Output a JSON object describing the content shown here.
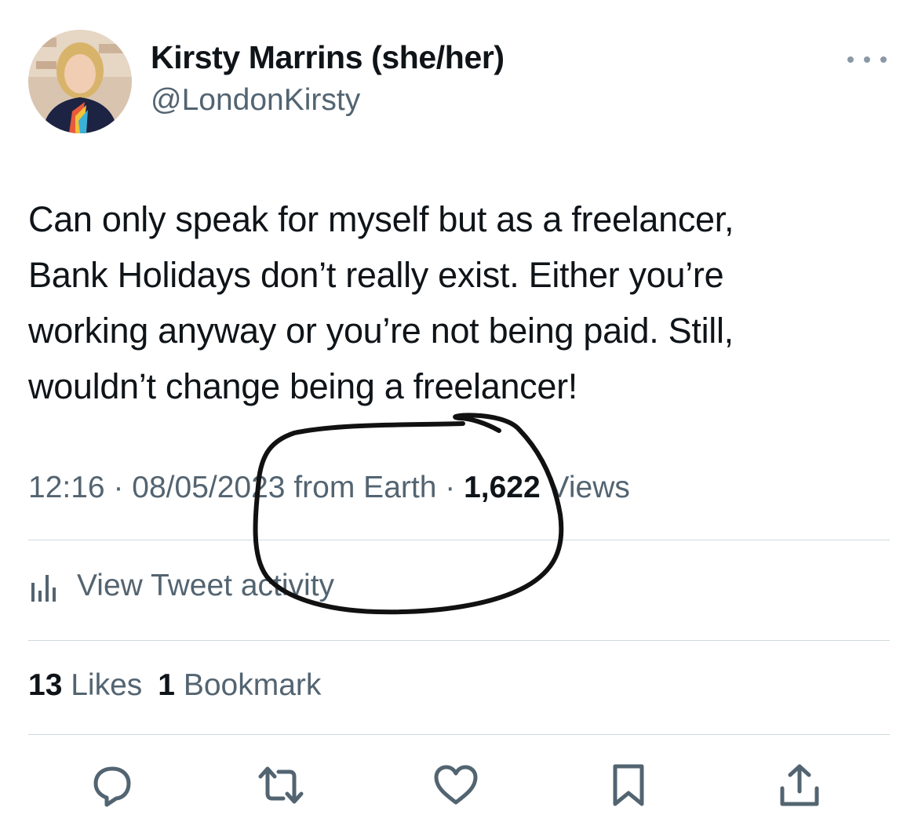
{
  "tweet": {
    "author": {
      "display_name": "Kirsty Marrins (she/her)",
      "handle": "@LondonKirsty"
    },
    "text_lines": [
      "Can only speak for myself but as a freelancer,",
      "Bank Holidays don’t really exist. Either you’re",
      "working anyway or you’re not being paid. Still,",
      "wouldn’t change being a freelancer!"
    ],
    "meta": {
      "time": "12:16",
      "separator": "·",
      "date": "08/05/2023",
      "source": "from Earth",
      "views_count": "1,622",
      "views_label": "Views"
    },
    "activity_label": "View Tweet activity",
    "stats": {
      "likes_count": "13",
      "likes_label": "Likes",
      "bookmarks_count": "1",
      "bookmarks_label": "Bookmark"
    }
  },
  "icons": {
    "more": "more-horizontal-icon",
    "activity": "bar-chart-icon",
    "reply": "reply-icon",
    "retweet": "retweet-icon",
    "like": "heart-icon",
    "bookmark": "bookmark-icon",
    "share": "share-icon"
  },
  "colors": {
    "text_primary": "#0f1419",
    "text_secondary": "#536471",
    "divider": "#cfd9de",
    "annotation_ink": "#111111"
  }
}
